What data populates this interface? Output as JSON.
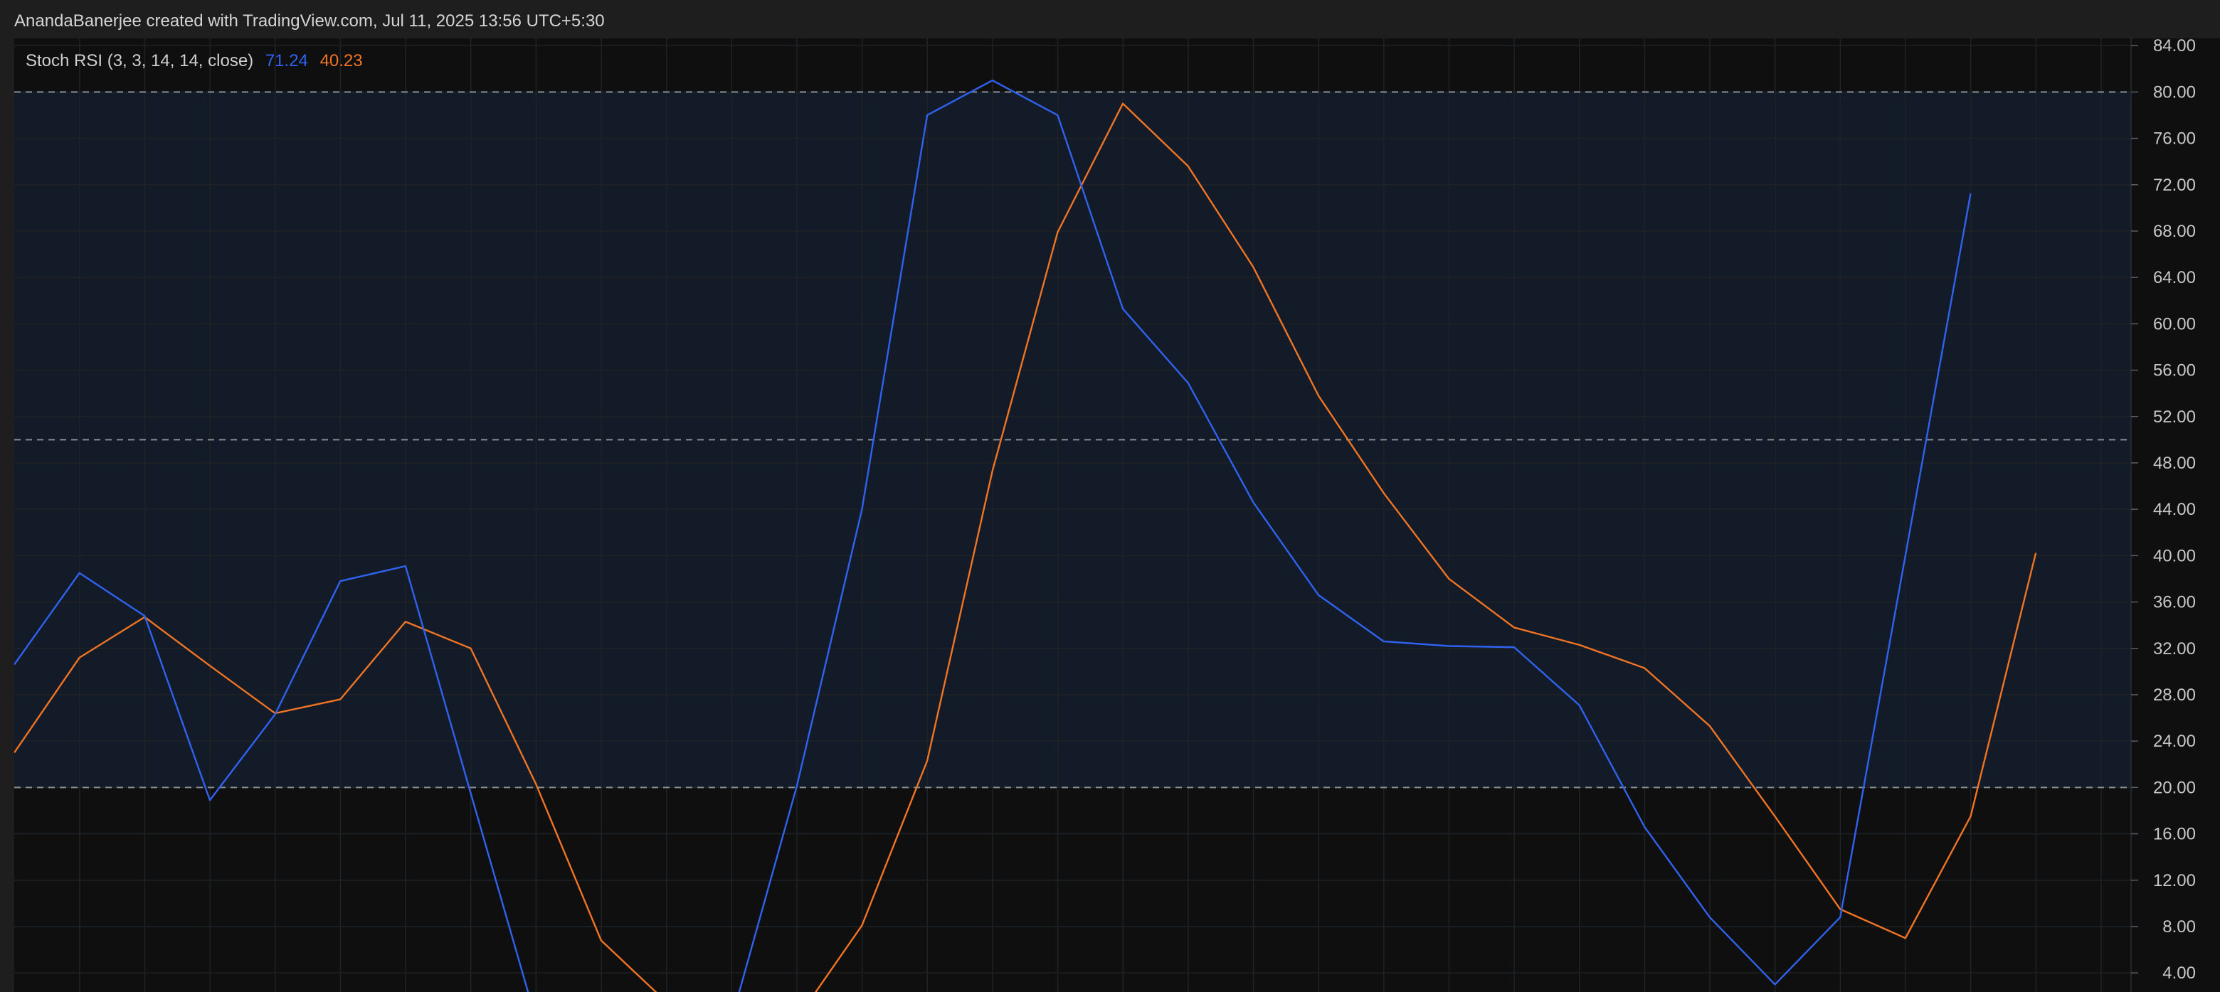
{
  "header": {
    "attribution": "AnandaBanerjee created with TradingView.com, Jul 11, 2025 13:56 UTC+5:30"
  },
  "legend": {
    "indicator": "Stoch RSI (3, 3, 14, 14, close)",
    "k_value": "71.24",
    "d_value": "40.23"
  },
  "colors": {
    "background": "#0f0f10",
    "band_fill": "#121b27",
    "grid": "#1f2326",
    "k_line": "#2f62f0",
    "d_line": "#f07424",
    "axis_text": "#c8c8c8",
    "band_line": "#8a8f96"
  },
  "chart_data": {
    "type": "line",
    "title": "Stoch RSI (3, 3, 14, 14, close)",
    "ylim": [
      2,
      84.5
    ],
    "y_ticks": [
      4,
      8,
      12,
      16,
      20,
      24,
      28,
      32,
      36,
      40,
      44,
      48,
      52,
      56,
      60,
      64,
      68,
      72,
      76,
      80,
      84
    ],
    "y_tick_labels": [
      "4.00",
      "8.00",
      "12.00",
      "16.00",
      "20.00",
      "24.00",
      "28.00",
      "32.00",
      "36.00",
      "40.00",
      "44.00",
      "48.00",
      "52.00",
      "56.00",
      "60.00",
      "64.00",
      "68.00",
      "72.00",
      "76.00",
      "80.00",
      "84.00"
    ],
    "bands": {
      "upper": 80,
      "middle": 50,
      "lower": 20
    },
    "grid": true,
    "series": [
      {
        "values": [
          30.6,
          38.5,
          34.8,
          18.9,
          26.3,
          37.8,
          39.1,
          19.5,
          0.0,
          0.0,
          0.0,
          0.0,
          20.1,
          44.0,
          78.0,
          81.0,
          78.0,
          61.3,
          54.9,
          44.6,
          36.6,
          32.6,
          32.2,
          32.1,
          27.1,
          16.6,
          8.8,
          3.0,
          8.8,
          40.0,
          71.24
        ]
      },
      {
        "values": [
          23.0,
          31.2,
          34.7,
          30.5,
          26.4,
          27.6,
          34.3,
          32.0,
          20.3,
          6.8,
          1.5,
          0.0,
          0.0,
          8.1,
          22.3,
          47.3,
          67.9,
          79.0,
          73.6,
          64.9,
          53.8,
          45.4,
          38.0,
          33.8,
          32.3,
          30.3,
          25.3,
          17.5,
          9.5,
          7.0,
          17.5,
          40.23
        ]
      }
    ]
  }
}
